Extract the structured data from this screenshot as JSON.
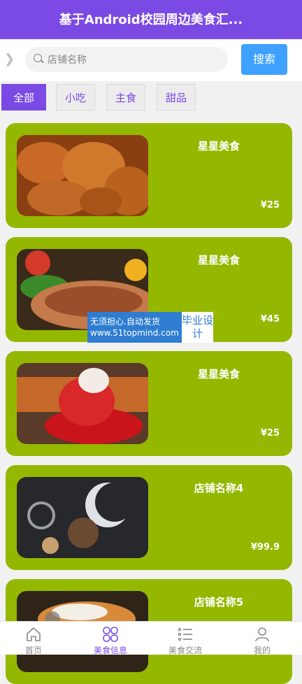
{
  "header": {
    "title": "基于Android校园周边美食汇..."
  },
  "search": {
    "placeholder": "店铺名称",
    "button_label": "搜索"
  },
  "categories": [
    {
      "label": "全部",
      "active": true
    },
    {
      "label": "小吃",
      "active": false
    },
    {
      "label": "主食",
      "active": false
    },
    {
      "label": "甜品",
      "active": false
    }
  ],
  "items": [
    {
      "name": "星星美食",
      "price": "¥25"
    },
    {
      "name": "星星美食",
      "price": "¥45"
    },
    {
      "name": "星星美食",
      "price": "¥25"
    },
    {
      "name": "店铺名称4",
      "price": "¥99.9"
    },
    {
      "name": "店铺名称5",
      "price": ""
    }
  ],
  "watermark": {
    "line1": "无须担心.自动发货",
    "line2": "www.51topmind.com",
    "side": "毕业设计"
  },
  "tabbar": [
    {
      "label": "首页",
      "icon": "home-icon",
      "active": false
    },
    {
      "label": "美食信息",
      "icon": "grid-icon",
      "active": true
    },
    {
      "label": "美食交流",
      "icon": "list-icon",
      "active": false
    },
    {
      "label": "我的",
      "icon": "user-icon",
      "active": false
    }
  ],
  "colors": {
    "header": "#7b49e3",
    "card": "#94b800",
    "search_button": "#3ea0ff"
  }
}
